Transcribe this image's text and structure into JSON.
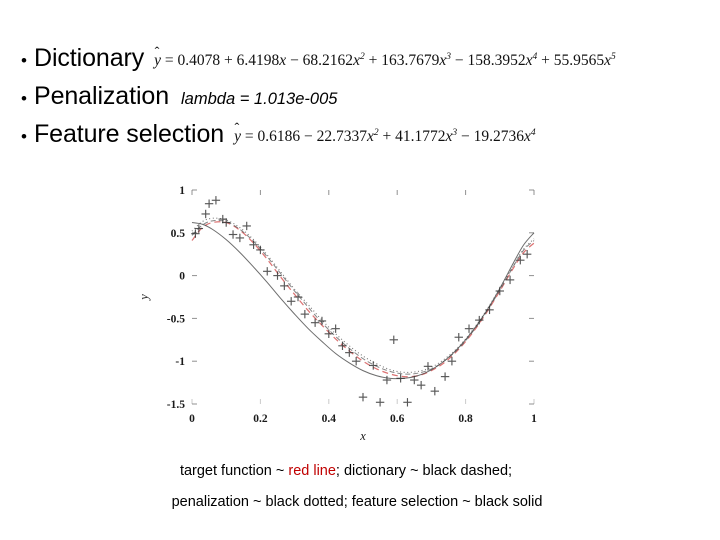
{
  "slide": {
    "bullets": [
      {
        "marker": "•",
        "label": "Dictionary",
        "equation_plain": "ŷ = 0.4078 + 6.4198x − 68.2162x² + 163.7679x³ − 158.3952x⁴ + 55.9565x⁵"
      },
      {
        "marker": "•",
        "label": "Penalization",
        "parameter_text": "lambda = 1.013e-005"
      },
      {
        "marker": "•",
        "label": "Feature selection",
        "equation_plain": "ŷ = 0.6186 − 22.7337x² + 41.1772x³ − 19.2736x⁴"
      }
    ],
    "equations": {
      "dictionary": {
        "lhs": "ŷ",
        "eq": "=",
        "terms": [
          {
            "sign": "",
            "coef": "0.4078",
            "var": "",
            "power": ""
          },
          {
            "sign": "+",
            "coef": "6.4198",
            "var": "x",
            "power": ""
          },
          {
            "sign": "−",
            "coef": "68.2162",
            "var": "x",
            "power": "2"
          },
          {
            "sign": "+",
            "coef": "163.7679",
            "var": "x",
            "power": "3"
          },
          {
            "sign": "−",
            "coef": "158.3952",
            "var": "x",
            "power": "4"
          },
          {
            "sign": "+",
            "coef": "55.9565",
            "var": "x",
            "power": "5"
          }
        ]
      },
      "feature_selection": {
        "lhs": "ŷ",
        "eq": "=",
        "terms": [
          {
            "sign": "",
            "coef": "0.6186",
            "var": "",
            "power": ""
          },
          {
            "sign": "−",
            "coef": "22.7337",
            "var": "x",
            "power": "2"
          },
          {
            "sign": "+",
            "coef": "41.1772",
            "var": "x",
            "power": "3"
          },
          {
            "sign": "−",
            "coef": "19.2736",
            "var": "x",
            "power": "4"
          }
        ]
      }
    },
    "penalization": {
      "lambda_label": "lambda",
      "equals": "=",
      "lambda_value": "1.013e-005"
    },
    "caption": {
      "line1_part1": "target function ~ ",
      "line1_red": "red line",
      "line1_part2": "; dictionary ~ black dashed;",
      "line2": "penalization ~ black dotted;  feature selection ~ black solid"
    },
    "colors": {
      "target_line": "#c00000",
      "fit_line": "#555555",
      "text": "#000000",
      "background": "#ffffff"
    }
  },
  "chart_data": {
    "type": "scatter",
    "title": "",
    "xlabel": "x",
    "ylabel": "y",
    "xlim": [
      0,
      1
    ],
    "ylim": [
      -1.5,
      1
    ],
    "xticks": [
      0,
      0.2,
      0.4,
      0.6,
      0.8,
      1
    ],
    "xtick_labels": [
      "0",
      "0.2",
      "0.4",
      "0.6",
      "0.8",
      "1"
    ],
    "yticks": [
      -1.5,
      -1,
      -0.5,
      0,
      0.5,
      1
    ],
    "ytick_labels": [
      "-1.5",
      "-1",
      "-0.5",
      "0",
      "0.5",
      "1"
    ],
    "grid": false,
    "legend": "none (described in caption below figure)",
    "series": [
      {
        "name": "target function",
        "style": "red solid line",
        "color": "#c00000",
        "x": [
          0.0,
          0.03,
          0.06,
          0.1,
          0.14,
          0.18,
          0.22,
          0.26,
          0.3,
          0.34,
          0.38,
          0.42,
          0.46,
          0.5,
          0.54,
          0.58,
          0.62,
          0.66,
          0.7,
          0.74,
          0.78,
          0.82,
          0.86,
          0.9,
          0.94,
          0.97,
          1.0
        ],
        "y": [
          0.41,
          0.56,
          0.62,
          0.62,
          0.53,
          0.38,
          0.19,
          -0.02,
          -0.22,
          -0.41,
          -0.58,
          -0.74,
          -0.88,
          -1.0,
          -1.09,
          -1.15,
          -1.18,
          -1.17,
          -1.11,
          -1.01,
          -0.86,
          -0.67,
          -0.44,
          -0.18,
          0.09,
          0.27,
          0.38
        ]
      },
      {
        "name": "dictionary",
        "style": "black dashed line",
        "color": "#555555",
        "x": [
          0.0,
          0.03,
          0.06,
          0.1,
          0.14,
          0.18,
          0.22,
          0.26,
          0.3,
          0.34,
          0.38,
          0.42,
          0.46,
          0.5,
          0.54,
          0.58,
          0.62,
          0.66,
          0.7,
          0.74,
          0.78,
          0.82,
          0.86,
          0.9,
          0.94,
          0.97,
          1.0
        ],
        "y": [
          0.47,
          0.59,
          0.64,
          0.63,
          0.54,
          0.4,
          0.22,
          0.02,
          -0.18,
          -0.37,
          -0.55,
          -0.71,
          -0.85,
          -0.97,
          -1.06,
          -1.12,
          -1.15,
          -1.14,
          -1.09,
          -0.99,
          -0.85,
          -0.66,
          -0.43,
          -0.17,
          0.11,
          0.3,
          0.41
        ]
      },
      {
        "name": "penalization",
        "style": "black dotted line",
        "color": "#555555",
        "x": [
          0.0,
          0.03,
          0.06,
          0.1,
          0.14,
          0.18,
          0.22,
          0.26,
          0.3,
          0.34,
          0.38,
          0.42,
          0.46,
          0.5,
          0.54,
          0.58,
          0.62,
          0.66,
          0.7,
          0.74,
          0.78,
          0.82,
          0.86,
          0.9,
          0.94,
          0.97,
          1.0
        ],
        "y": [
          0.52,
          0.63,
          0.67,
          0.65,
          0.56,
          0.42,
          0.24,
          0.04,
          -0.16,
          -0.34,
          -0.52,
          -0.68,
          -0.82,
          -0.94,
          -1.03,
          -1.1,
          -1.13,
          -1.12,
          -1.07,
          -0.97,
          -0.83,
          -0.64,
          -0.41,
          -0.15,
          0.12,
          0.31,
          0.43
        ]
      },
      {
        "name": "feature selection",
        "style": "black solid line",
        "color": "#444444",
        "x": [
          0.0,
          0.03,
          0.06,
          0.1,
          0.14,
          0.18,
          0.22,
          0.26,
          0.3,
          0.34,
          0.38,
          0.42,
          0.46,
          0.5,
          0.54,
          0.58,
          0.62,
          0.66,
          0.7,
          0.74,
          0.78,
          0.82,
          0.86,
          0.9,
          0.94,
          0.97,
          1.0
        ],
        "y": [
          0.62,
          0.6,
          0.54,
          0.42,
          0.27,
          0.1,
          -0.08,
          -0.27,
          -0.45,
          -0.62,
          -0.77,
          -0.91,
          -1.02,
          -1.11,
          -1.17,
          -1.2,
          -1.2,
          -1.17,
          -1.1,
          -0.99,
          -0.84,
          -0.65,
          -0.42,
          -0.15,
          0.15,
          0.36,
          0.5
        ]
      }
    ],
    "scatter_points": {
      "name": "noisy samples",
      "marker": "+",
      "color": "#333333",
      "x": [
        0.01,
        0.02,
        0.04,
        0.05,
        0.07,
        0.09,
        0.1,
        0.12,
        0.14,
        0.16,
        0.18,
        0.2,
        0.22,
        0.25,
        0.27,
        0.29,
        0.31,
        0.33,
        0.36,
        0.38,
        0.4,
        0.42,
        0.44,
        0.46,
        0.48,
        0.5,
        0.53,
        0.55,
        0.57,
        0.59,
        0.61,
        0.63,
        0.65,
        0.67,
        0.69,
        0.71,
        0.74,
        0.76,
        0.78,
        0.81,
        0.84,
        0.87,
        0.9,
        0.93,
        0.96,
        0.98
      ],
      "y": [
        0.49,
        0.55,
        0.72,
        0.84,
        0.88,
        0.66,
        0.62,
        0.48,
        0.44,
        0.58,
        0.36,
        0.3,
        0.05,
        0.0,
        -0.12,
        -0.3,
        -0.25,
        -0.45,
        -0.55,
        -0.53,
        -0.68,
        -0.62,
        -0.82,
        -0.9,
        -1.0,
        -1.42,
        -1.05,
        -1.48,
        -1.22,
        -0.75,
        -1.2,
        -1.48,
        -1.22,
        -1.28,
        -1.06,
        -1.35,
        -1.18,
        -1.0,
        -0.72,
        -0.62,
        -0.52,
        -0.4,
        -0.18,
        -0.05,
        0.18,
        0.25
      ]
    }
  }
}
